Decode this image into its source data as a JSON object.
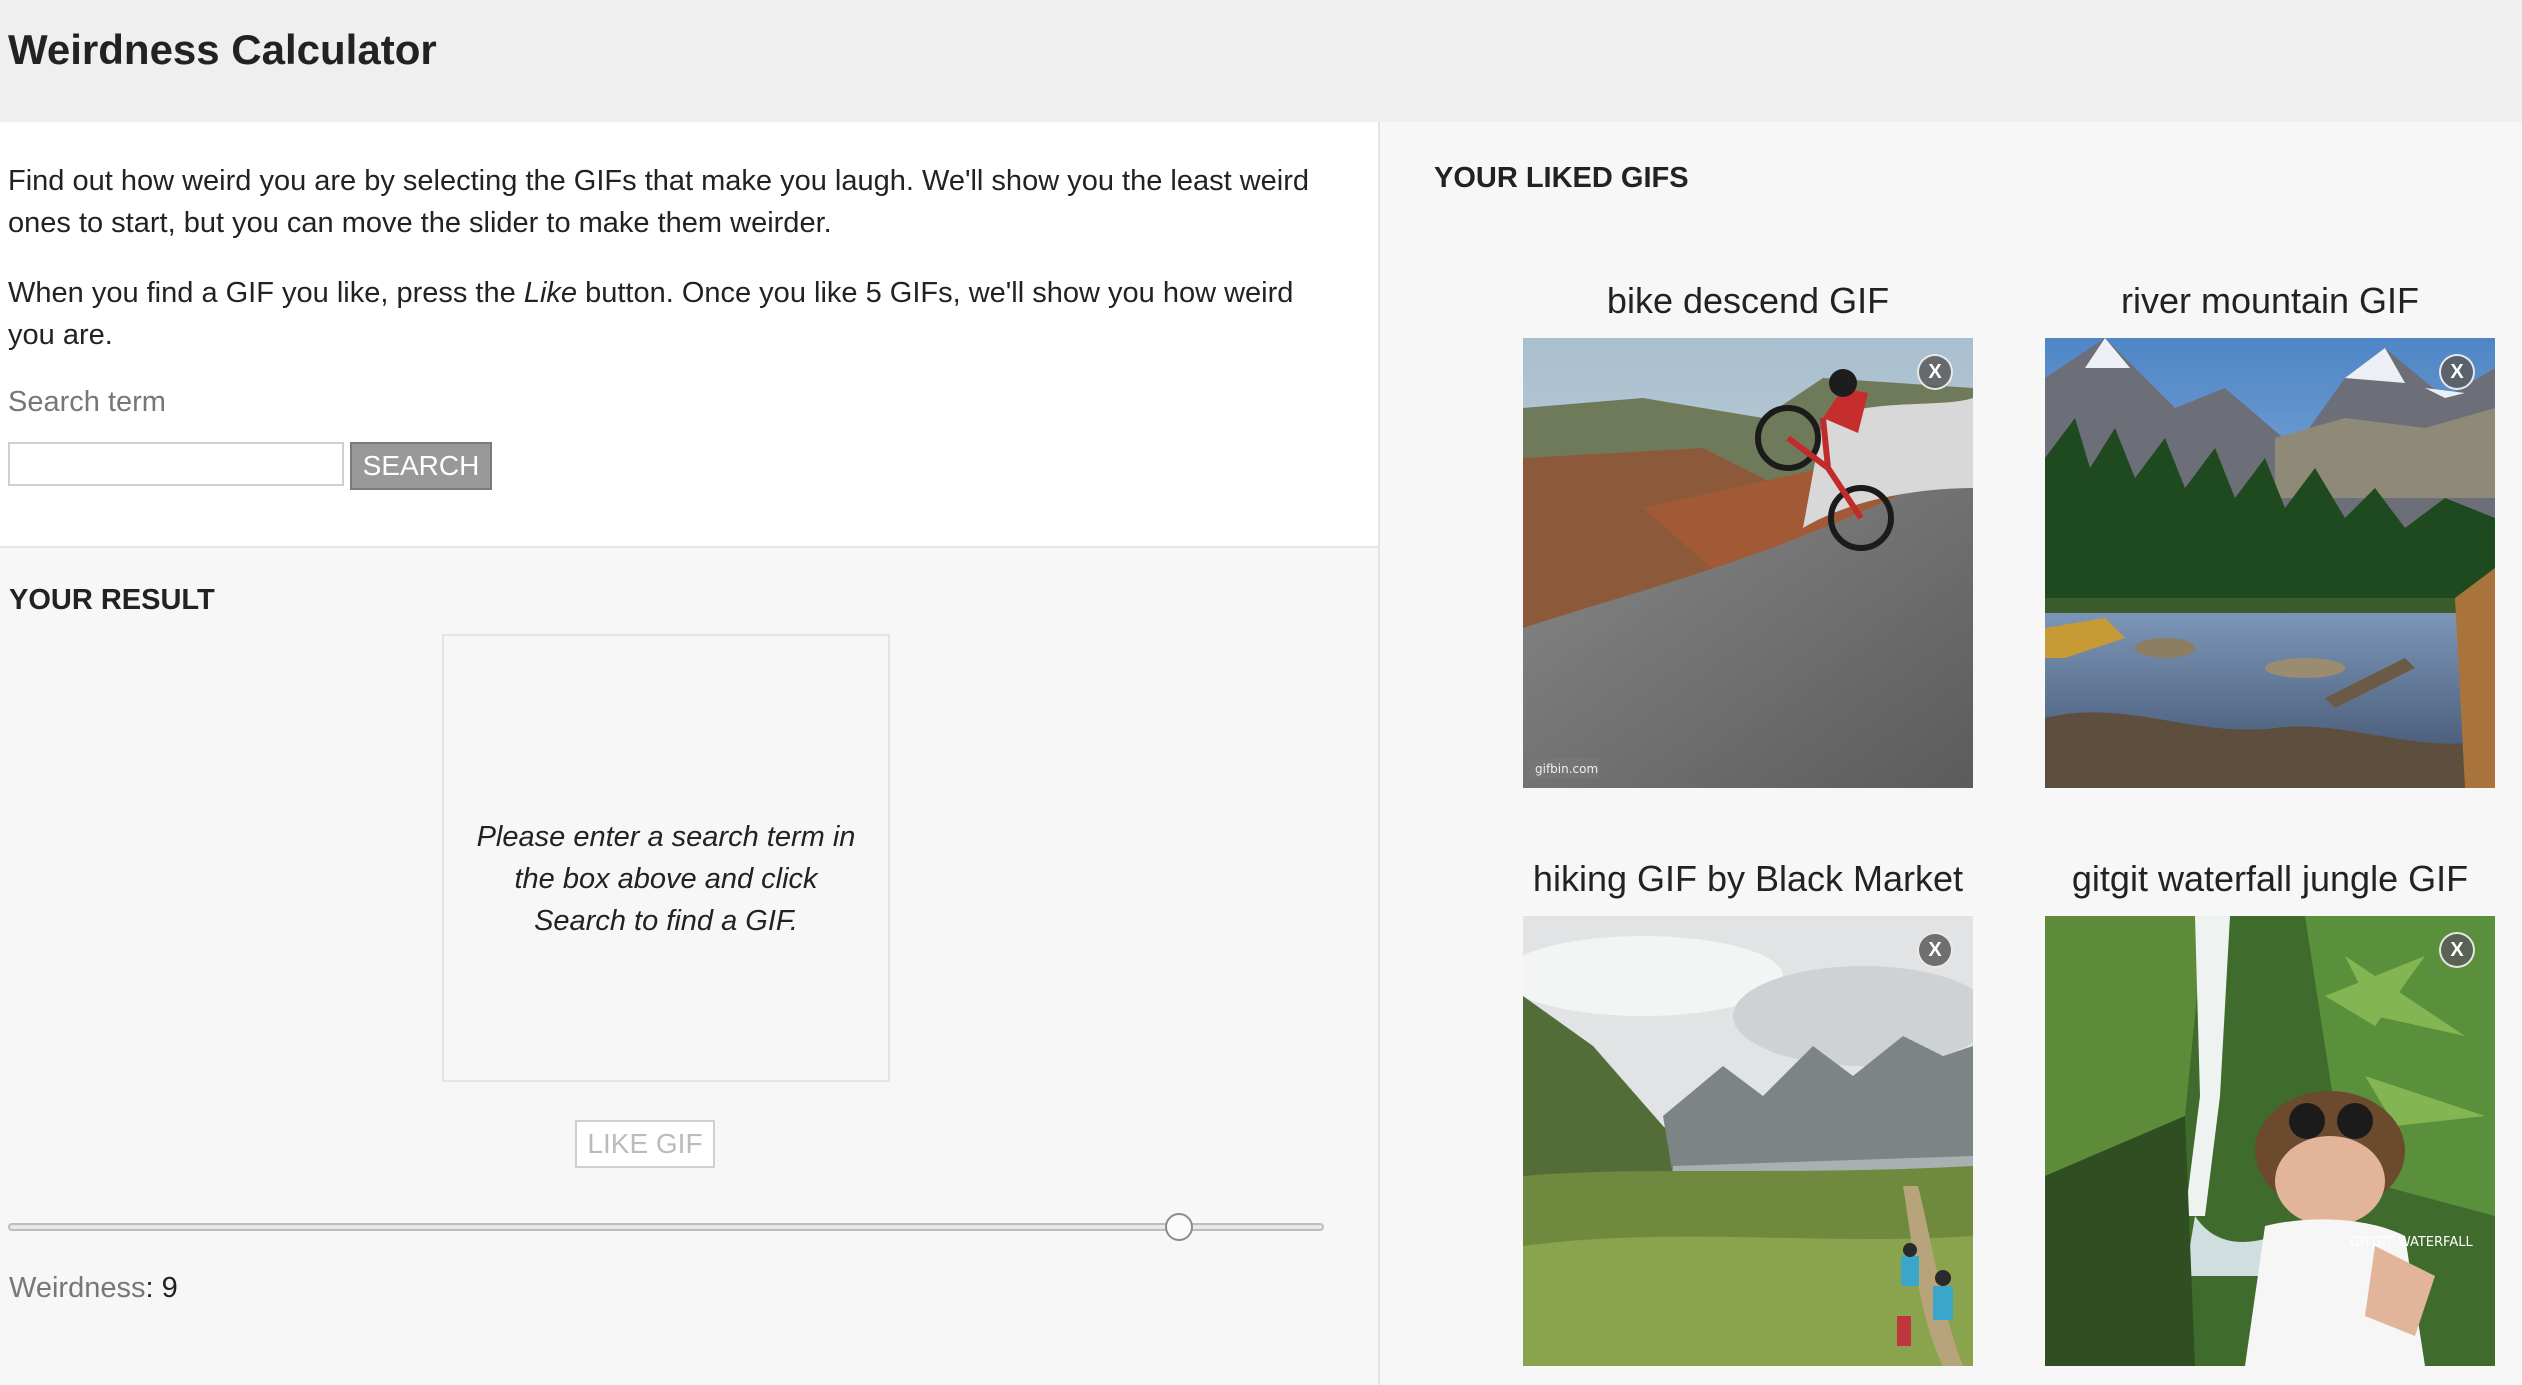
{
  "app": {
    "title": "Weirdness Calculator"
  },
  "intro": {
    "paragraph_1": "Find out how weird you are by selecting the GIFs that make you laugh. We'll show you the least weird ones to start, but you can move the slider to make them weirder.",
    "paragraph_2_before": "When you find a GIF you like, press the ",
    "paragraph_2_emphasis": "Like",
    "paragraph_2_after": " button. Once you like 5 GIFs, we'll show you how weird you are."
  },
  "search": {
    "label": "Search term",
    "input_value": "",
    "button_label": "SEARCH"
  },
  "result": {
    "heading": "YOUR RESULT",
    "placeholder": "Please enter a search term in the box above and click Search to find a GIF.",
    "like_button_label": "LIKE GIF",
    "slider_value": 9,
    "weirdness_label": "Weirdness",
    "weirdness_colon": ": ",
    "weirdness_value": "9"
  },
  "liked_gifs": {
    "heading": "YOUR LIKED GIFS",
    "remove_label": "X",
    "items": [
      {
        "title": "bike descend GIF",
        "watermark": "gifbin.com"
      },
      {
        "title": "river mountain GIF"
      },
      {
        "title": "hiking GIF by Black Market"
      },
      {
        "title": "gitgit waterfall jungle GIF",
        "watermark": "GITGIT WATERFALL"
      }
    ]
  },
  "colors": {
    "header_bg": "#efefef",
    "panel_bg": "#f7f7f7",
    "search_button_bg": "#999999",
    "like_button_text": "#bbbbbb"
  }
}
